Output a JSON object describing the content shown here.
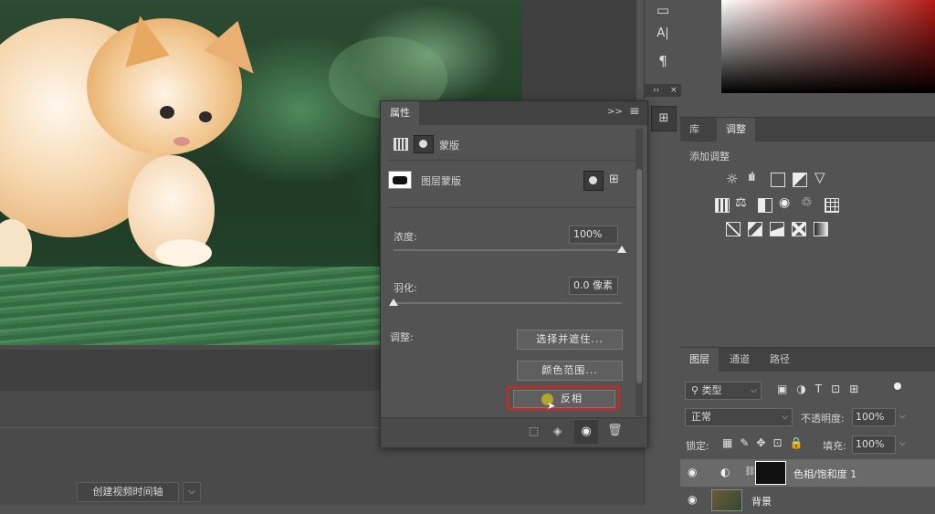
{
  "properties_panel": {
    "title": "属性",
    "double_arrow": ">>",
    "menu_glyph": "≡",
    "mask_header_label": "蒙版",
    "layer_mask_label": "图层蒙版",
    "density_label": "浓度:",
    "density_value": "100%",
    "density_level_pct": 100,
    "feather_label": "羽化:",
    "feather_value": "0.0 像素",
    "feather_level_pct": 0,
    "adjust_label": "调整:",
    "select_and_mask_label": "选择并遮住...",
    "color_range_label": "颜色范围...",
    "invert_label": "反相",
    "highlight_color": "#e0201b"
  },
  "adjustments_panel": {
    "tabs": [
      "库",
      "调整"
    ],
    "add_adjustment_label": "添加调整",
    "icons_row1": [
      "brightness-icon",
      "levels-icon",
      "curves-icon",
      "exposure-icon",
      "vibrance-icon"
    ],
    "icons_row2": [
      "hue-saturation-icon",
      "color-balance-icon",
      "black-white-icon",
      "photo-filter-icon",
      "channel-mixer-icon",
      "color-lookup-icon"
    ],
    "icons_row3": [
      "invert-icon",
      "posterize-icon",
      "threshold-icon",
      "selective-color-icon",
      "gradient-map-icon"
    ]
  },
  "layers_panel": {
    "tabs": [
      "图层",
      "通道",
      "路径"
    ],
    "filter_label": "类型",
    "blend_mode": "正常",
    "opacity_label": "不透明度:",
    "opacity_value": "100%",
    "lock_label": "锁定:",
    "fill_label": "填充:",
    "fill_value": "100%",
    "layers": [
      {
        "name": "色相/饱和度 1"
      },
      {
        "name": "背景"
      }
    ]
  },
  "timeline": {
    "create_video_label": "创建视频时间轴"
  },
  "tools": {
    "text_tool_label": "A|",
    "paragraph_label": "¶"
  }
}
